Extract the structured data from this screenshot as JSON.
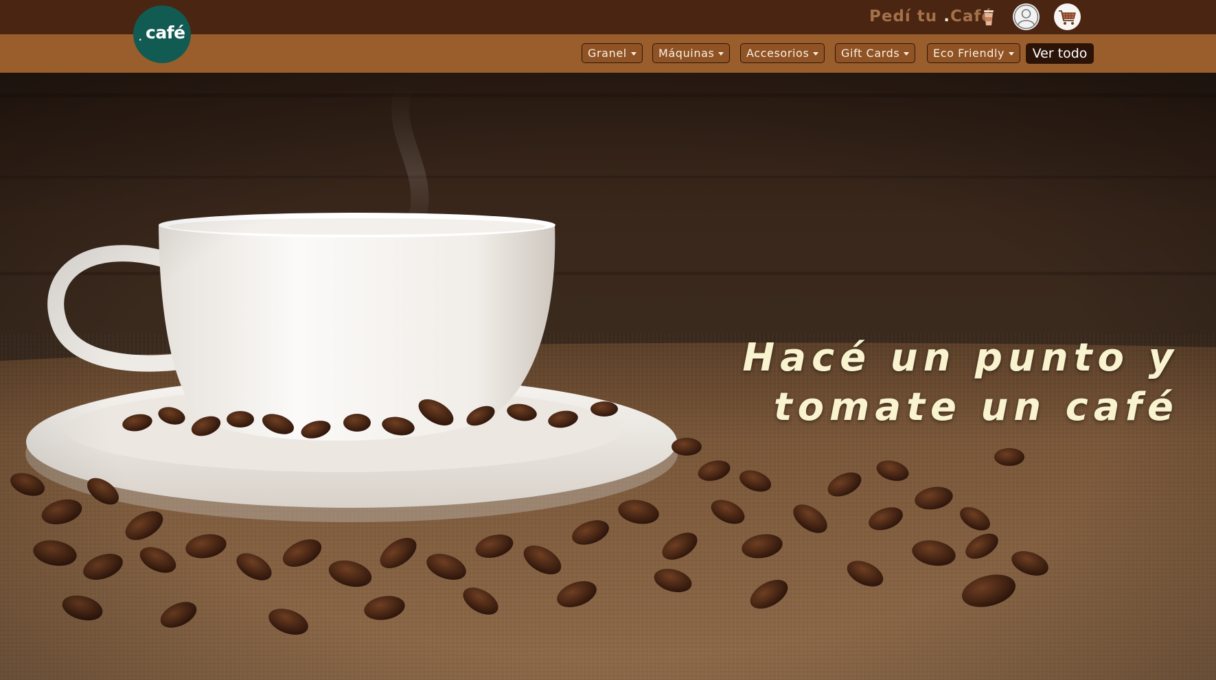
{
  "header": {
    "tagline_prefix": "Pedí tu ",
    "tagline_dot": ".",
    "tagline_suffix": "Café",
    "cup_icon": "coffee-cup-icon",
    "user_icon": "user-avatar-icon",
    "cart_icon": "shopping-cart-icon",
    "colors": {
      "topbar": "#4a2511",
      "tagline": "#a47149"
    }
  },
  "logo": {
    "dot": ".",
    "text": "café",
    "color": "#115b53"
  },
  "nav": {
    "background": "#9a5e2c",
    "items": [
      {
        "label": "Granel",
        "has_dropdown": true
      },
      {
        "label": "Máquinas",
        "has_dropdown": true
      },
      {
        "label": "Accesorios",
        "has_dropdown": true
      },
      {
        "label": "Gift Cards",
        "has_dropdown": true
      },
      {
        "label": "Eco Friendly",
        "has_dropdown": true
      }
    ],
    "ver_todo": "Ver todo"
  },
  "hero": {
    "line1": "Hacé un punto y",
    "line2": "tomate un café",
    "text_color": "#f9f3cf"
  }
}
